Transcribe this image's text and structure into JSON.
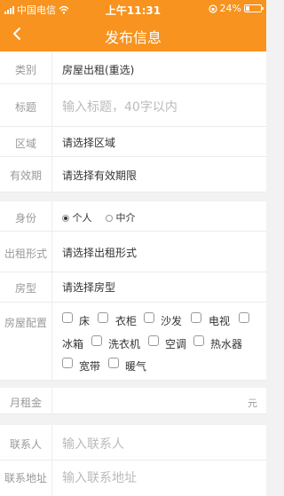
{
  "status_bar": {
    "carrier": "中国电信",
    "time": "上午11:31",
    "battery": "24%",
    "battery_level": 0.24
  },
  "nav": {
    "title": "发布信息"
  },
  "form": {
    "category": {
      "label": "类别",
      "value": "房屋出租(重选)"
    },
    "title": {
      "label": "标题",
      "placeholder": "输入标题，40字以内"
    },
    "area": {
      "label": "区域",
      "value": "请选择区域"
    },
    "validity": {
      "label": "有效期",
      "value": "请选择有效期限"
    },
    "identity": {
      "label": "身份",
      "options": [
        "个人",
        "中介"
      ],
      "selected": "个人"
    },
    "rent_type": {
      "label": "出租形式",
      "value": "请选择出租形式"
    },
    "room_type": {
      "label": "房型",
      "value": "请选择房型"
    },
    "facilities": {
      "label": "房屋配置",
      "options": [
        "床",
        "衣柜",
        "沙发",
        "电视",
        "冰箱",
        "洗衣机",
        "空调",
        "热水器",
        "宽带",
        "暖气"
      ]
    },
    "rent": {
      "label": "月租金",
      "unit": "元"
    },
    "contact": {
      "label": "联系人",
      "placeholder": "输入联系人"
    },
    "address": {
      "label": "联系地址",
      "placeholder": "输入联系地址"
    }
  }
}
